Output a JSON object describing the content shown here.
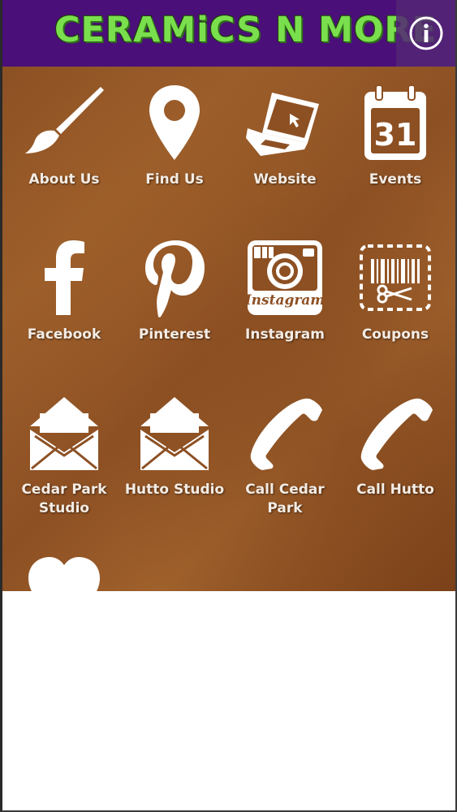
{
  "header": {
    "title": "CERAMiCS N MORE",
    "title_color": "#7adf4d",
    "background": "#4a0f78",
    "info_icon": "info-icon"
  },
  "tiles": [
    {
      "label": "About Us",
      "icon": "paintbrush-icon"
    },
    {
      "label": "Find Us",
      "icon": "map-pin-icon"
    },
    {
      "label": "Website",
      "icon": "laptop-icon"
    },
    {
      "label": "Events",
      "icon": "calendar-icon",
      "calendar_day": "31"
    },
    {
      "label": "Facebook",
      "icon": "facebook-icon"
    },
    {
      "label": "Pinterest",
      "icon": "pinterest-icon"
    },
    {
      "label": "Instagram",
      "icon": "instagram-icon",
      "wordmark": "Instagram"
    },
    {
      "label": "Coupons",
      "icon": "coupon-barcode-icon"
    },
    {
      "label": "Cedar Park Studio",
      "icon": "envelope-icon"
    },
    {
      "label": "Hutto Studio",
      "icon": "envelope-icon"
    },
    {
      "label": "Call Cedar Park",
      "icon": "phone-icon"
    },
    {
      "label": "Call Hutto",
      "icon": "phone-icon"
    },
    {
      "label": "",
      "icon": "heart-icon"
    }
  ]
}
